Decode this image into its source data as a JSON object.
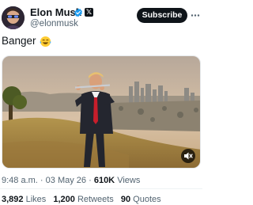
{
  "author": {
    "name": "Elon Musk",
    "handle": "@elonmusk",
    "verified_icon": "verified-badge-icon",
    "affiliation_icon": "x-logo-icon",
    "affiliation_glyph": "𝕏"
  },
  "subscribe_label": "Subscribe",
  "post": {
    "text": "Banger",
    "emoji_icon": "laughing-tears-emoji-icon"
  },
  "media": {
    "type": "video",
    "mute_icon": "speaker-muted-icon"
  },
  "meta": {
    "time": "9:48 a.m.",
    "separator": "·",
    "date": "03 May 26",
    "views_count": "610K",
    "views_label": "Views"
  },
  "stats": {
    "likes_count": "3,892",
    "likes_label": "Likes",
    "retweets_count": "1,200",
    "retweets_label": "Retweets",
    "quotes_count": "90",
    "quotes_label": "Quotes"
  },
  "colors": {
    "text": "#0f1419",
    "secondary": "#536471",
    "verified": "#1d9bf0",
    "button": "#0f1419"
  }
}
